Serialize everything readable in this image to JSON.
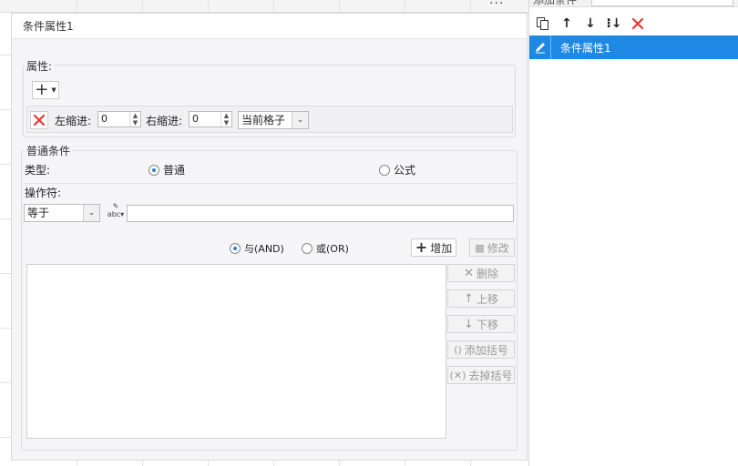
{
  "dialog": {
    "title": "条件属性1"
  },
  "properties": {
    "legend": "属性:",
    "add_symbol": "+",
    "left_indent_label": "左缩进:",
    "left_indent_value": "0",
    "right_indent_label": "右缩进:",
    "right_indent_value": "0",
    "scope_select": "当前格子"
  },
  "normal_condition": {
    "legend": "普通条件",
    "type_label": "类型:",
    "type_normal": "普通",
    "type_formula": "公式",
    "operator_label": "操作符:",
    "operator_value": "等于",
    "value_input": ""
  },
  "logic": {
    "and_label": "与(AND)",
    "or_label": "或(OR)"
  },
  "actions": {
    "add": "增加",
    "modify": "修改",
    "delete": "删除",
    "move_up": "上移",
    "move_down": "下移",
    "add_bracket": "添加括号",
    "remove_bracket": "去掉括号"
  },
  "right_panel": {
    "header_label": "添加条件",
    "items": [
      {
        "label": "条件属性1",
        "selected": true
      }
    ]
  },
  "colors": {
    "accent": "#1e88e5",
    "delete_red": "#e53935"
  }
}
